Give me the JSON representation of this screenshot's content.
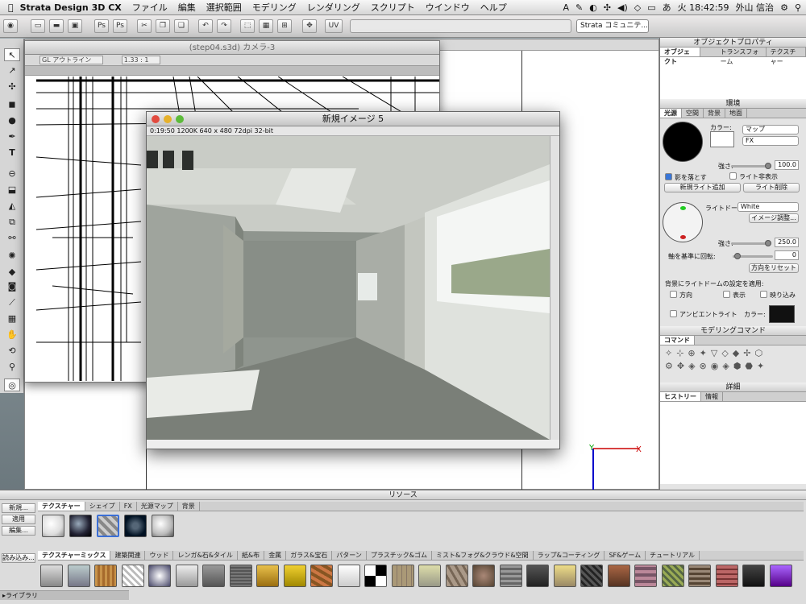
{
  "app": {
    "name": "Strata Design 3D CX"
  },
  "menu": [
    "ファイル",
    "編集",
    "選択範囲",
    "モデリング",
    "レンダリング",
    "スクリプト",
    "ウインドウ",
    "ヘルプ"
  ],
  "status": {
    "time": "火 18:42:59",
    "user": "外山 信治"
  },
  "toolbar": {
    "community": "Strata コミュニテ..."
  },
  "camera_window": {
    "title": "(step04.s3d) カメラ-3",
    "view_mode": "GL アウトライン",
    "zoom": "1.33 : 1"
  },
  "render_window": {
    "title": "新規イメージ 5",
    "info": "0:19:50   1200K   640 x 480   72dpi   32-bit"
  },
  "panels": {
    "object_props": {
      "title": "オブジェクトプロパティ",
      "tabs": [
        "オブジェクト",
        "トランスフォーム",
        "テクスチャー"
      ]
    },
    "environment": {
      "title": "環境",
      "tabs": [
        "光源",
        "空間",
        "背景",
        "地面"
      ],
      "color_label": "カラー:",
      "map": "マップ",
      "fx": "FX",
      "strength_label": "強さ:",
      "strength_value": "100.0",
      "cast_shadow": "影を落とす",
      "hide_lights": "ライト非表示",
      "add_light": "新規ライト追加",
      "delete_light": "ライト削除",
      "lightdome_label": "ライトドーム:",
      "lightdome_value": "White",
      "image_adjust": "イメージ調整...",
      "dome_strength_value": "250.0",
      "axis_rotate_label": "軸を基準に回転:",
      "axis_rotate_value": "0",
      "reset_dir": "方向をリセット",
      "apply_bg": "背景にライトドームの設定を適用:",
      "dir": "方向",
      "show": "表示",
      "reflect": "映り込み",
      "ambient": "アンビエントライト"
    },
    "modeling": {
      "title": "モデリングコマンド",
      "tab": "コマンド"
    },
    "detail": {
      "title": "詳細",
      "tabs": [
        "ヒストリー",
        "情報"
      ]
    }
  },
  "resources": {
    "title": "リソース",
    "buttons": [
      "新規...",
      "適用",
      "編集...",
      "読み込み..."
    ],
    "library": "▸ライブラリ",
    "tabs": [
      "テクスチャー",
      "シェイプ",
      "FX",
      "光源マップ",
      "背景"
    ],
    "categories": [
      "テクスチャーミックス",
      "建築関連",
      "ウッド",
      "レンガ&石&タイル",
      "紙&布",
      "金属",
      "ガラス&宝石",
      "パターン",
      "プラスチック&ゴム",
      "ミスト&フォグ&クラウド&空間",
      "ラップ&コーティング",
      "SF&ゲーム",
      "チュートリアル"
    ]
  }
}
